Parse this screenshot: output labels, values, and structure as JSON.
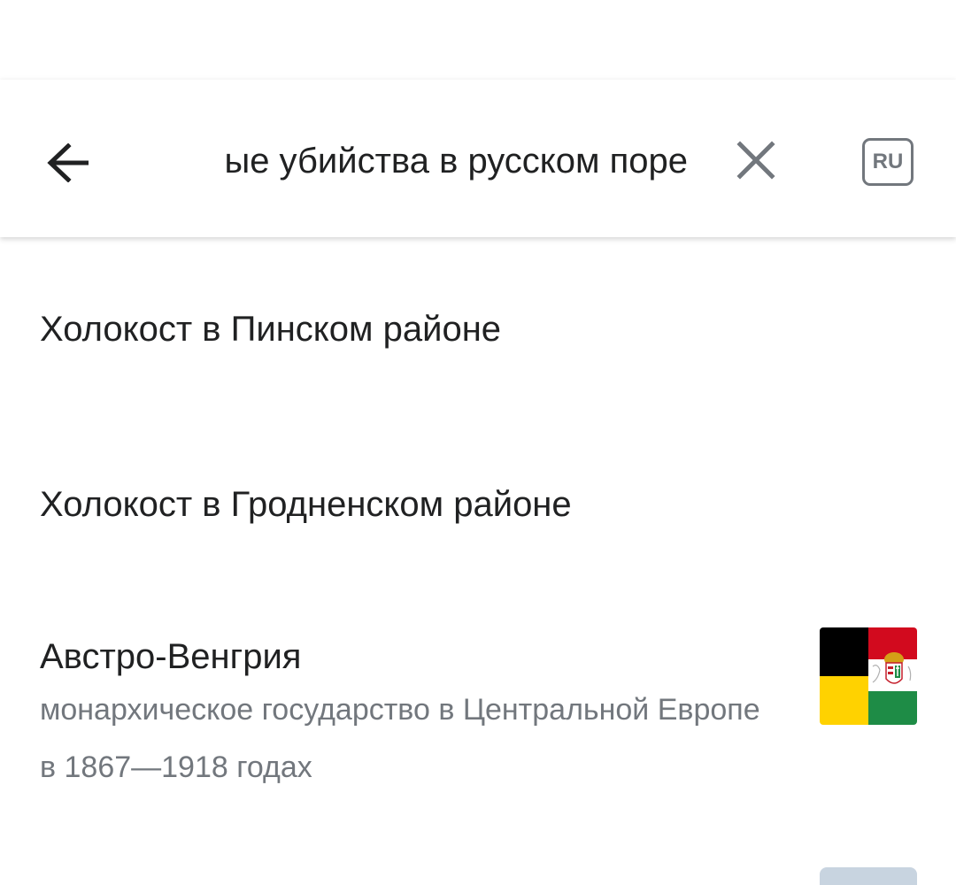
{
  "search": {
    "query": "ые убийства в русском поре"
  },
  "toolbar": {
    "back_icon": "arrow-left-icon",
    "clear_icon": "close-icon",
    "language_label": "RU"
  },
  "results": [
    {
      "title": "Холокост в Пинском районе",
      "description": ""
    },
    {
      "title": "Холокост в Гродненском районе",
      "description": ""
    },
    {
      "title": "Австро-Венгрия",
      "description": "монархическое государство в Центральной Европе в 1867—1918 годах",
      "thumbnail": "austria-hungary-flag"
    }
  ],
  "colors": {
    "text_primary": "#202122",
    "text_secondary": "#72777d",
    "icon": "#202122",
    "icon_secondary": "#72777d"
  }
}
